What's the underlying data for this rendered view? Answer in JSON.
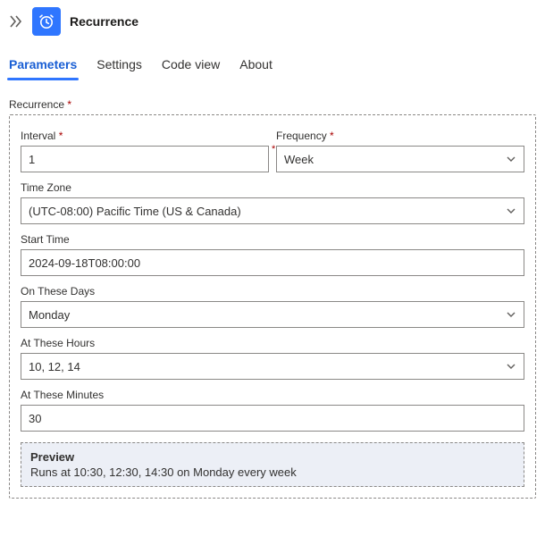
{
  "header": {
    "title": "Recurrence"
  },
  "tabs": {
    "items": [
      {
        "label": "Parameters"
      },
      {
        "label": "Settings"
      },
      {
        "label": "Code view"
      },
      {
        "label": "About"
      }
    ]
  },
  "form": {
    "section_label": "Recurrence",
    "interval": {
      "label": "Interval",
      "value": "1"
    },
    "frequency": {
      "label": "Frequency",
      "value": "Week"
    },
    "timezone": {
      "label": "Time Zone",
      "value": "(UTC-08:00) Pacific Time (US & Canada)"
    },
    "start_time": {
      "label": "Start Time",
      "value": "2024-09-18T08:00:00"
    },
    "on_days": {
      "label": "On These Days",
      "value": "Monday"
    },
    "at_hours": {
      "label": "At These Hours",
      "value": "10, 12, 14"
    },
    "at_minutes": {
      "label": "At These Minutes",
      "value": "30"
    }
  },
  "preview": {
    "title": "Preview",
    "body": "Runs at 10:30, 12:30, 14:30 on Monday every week"
  }
}
